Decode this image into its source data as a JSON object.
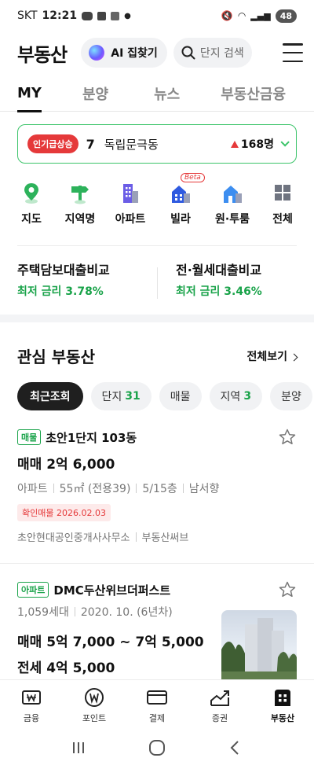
{
  "status_bar": {
    "carrier": "SKT",
    "time": "12:21",
    "battery": "48"
  },
  "header": {
    "title": "부동산",
    "ai_button": "AI 집찾기",
    "search_placeholder": "단지 검색"
  },
  "tabs": [
    {
      "label": "MY",
      "active": true
    },
    {
      "label": "분양"
    },
    {
      "label": "뉴스"
    },
    {
      "label": "부동산금융"
    }
  ],
  "trending": {
    "badge": "인기급상승",
    "rank": "7",
    "name": "독립문극동",
    "count": "168명",
    "accent": "#3cc46a",
    "badge_color": "#e5393a"
  },
  "categories": [
    {
      "label": "지도",
      "icon": "map-pin-icon"
    },
    {
      "label": "지역명",
      "icon": "signpost-icon"
    },
    {
      "label": "아파트",
      "icon": "apartment-icon"
    },
    {
      "label": "빌라",
      "icon": "villa-icon",
      "badge": "Beta"
    },
    {
      "label": "원·투룸",
      "icon": "house-icon"
    },
    {
      "label": "전체",
      "icon": "grid-icon"
    }
  ],
  "loans": [
    {
      "title": "주택담보대출비교",
      "subtitle": "최저 금리 3.78%"
    },
    {
      "title": "전·월세대출비교",
      "subtitle": "최저 금리 3.46%"
    }
  ],
  "interest": {
    "title": "관심 부동산",
    "see_all": "전체보기",
    "chips": [
      {
        "label": "최근조회",
        "active": true
      },
      {
        "label": "단지",
        "count": "31"
      },
      {
        "label": "매물"
      },
      {
        "label": "지역",
        "count": "3"
      },
      {
        "label": "분양"
      }
    ]
  },
  "listings": [
    {
      "tag": "매물",
      "name": "초안1단지 103동",
      "price": "매매 2억 6,000",
      "meta": [
        "아파트",
        "55㎡ (전용39)",
        "5/15층",
        "남서향"
      ],
      "confirm": "확인매물 2026.02.03",
      "agent": [
        "초안현대공인중개사사무소",
        "부동산써브"
      ]
    },
    {
      "tag": "아파트",
      "name": "DMC두산위브더퍼스트",
      "meta": [
        "1,059세대",
        "2020. 10. (6년차)"
      ],
      "price": "매매 5억 7,000 ~ 7억 5,000",
      "price2": "전세 4억 5,000"
    }
  ],
  "bottom_nav": [
    {
      "label": "금융",
      "icon": "won-card-icon"
    },
    {
      "label": "포인트",
      "icon": "won-coin-icon"
    },
    {
      "label": "결제",
      "icon": "card-icon"
    },
    {
      "label": "증권",
      "icon": "chart-icon"
    },
    {
      "label": "부동산",
      "icon": "building-icon",
      "active": true
    }
  ]
}
